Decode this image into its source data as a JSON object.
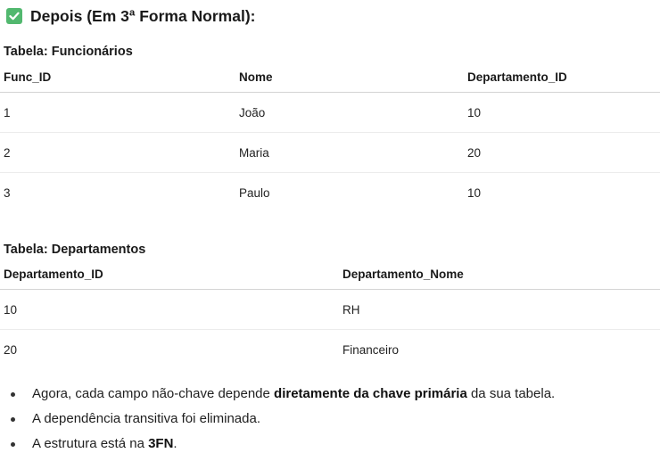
{
  "section_heading": "Depois (Em 3ª Forma Normal):",
  "heading_icon": "check-icon",
  "table1": {
    "title": "Tabela: Funcionários",
    "headers": [
      "Func_ID",
      "Nome",
      "Departamento_ID"
    ],
    "rows": [
      [
        "1",
        "João",
        "10"
      ],
      [
        "2",
        "Maria",
        "20"
      ],
      [
        "3",
        "Paulo",
        "10"
      ]
    ]
  },
  "table2": {
    "title": "Tabela: Departamentos",
    "headers": [
      "Departamento_ID",
      "Departamento_Nome"
    ],
    "rows": [
      [
        "10",
        "RH"
      ],
      [
        "20",
        "Financeiro"
      ]
    ]
  },
  "bullets": [
    {
      "pre": "Agora, cada campo não-chave depende ",
      "bold": "diretamente da chave primária",
      "post": " da sua tabela."
    },
    {
      "pre": "A dependência transitiva foi eliminada.",
      "bold": "",
      "post": ""
    },
    {
      "pre": "A estrutura está na ",
      "bold": "3FN",
      "post": "."
    }
  ],
  "colors": {
    "check_badge": "#52b86f"
  }
}
